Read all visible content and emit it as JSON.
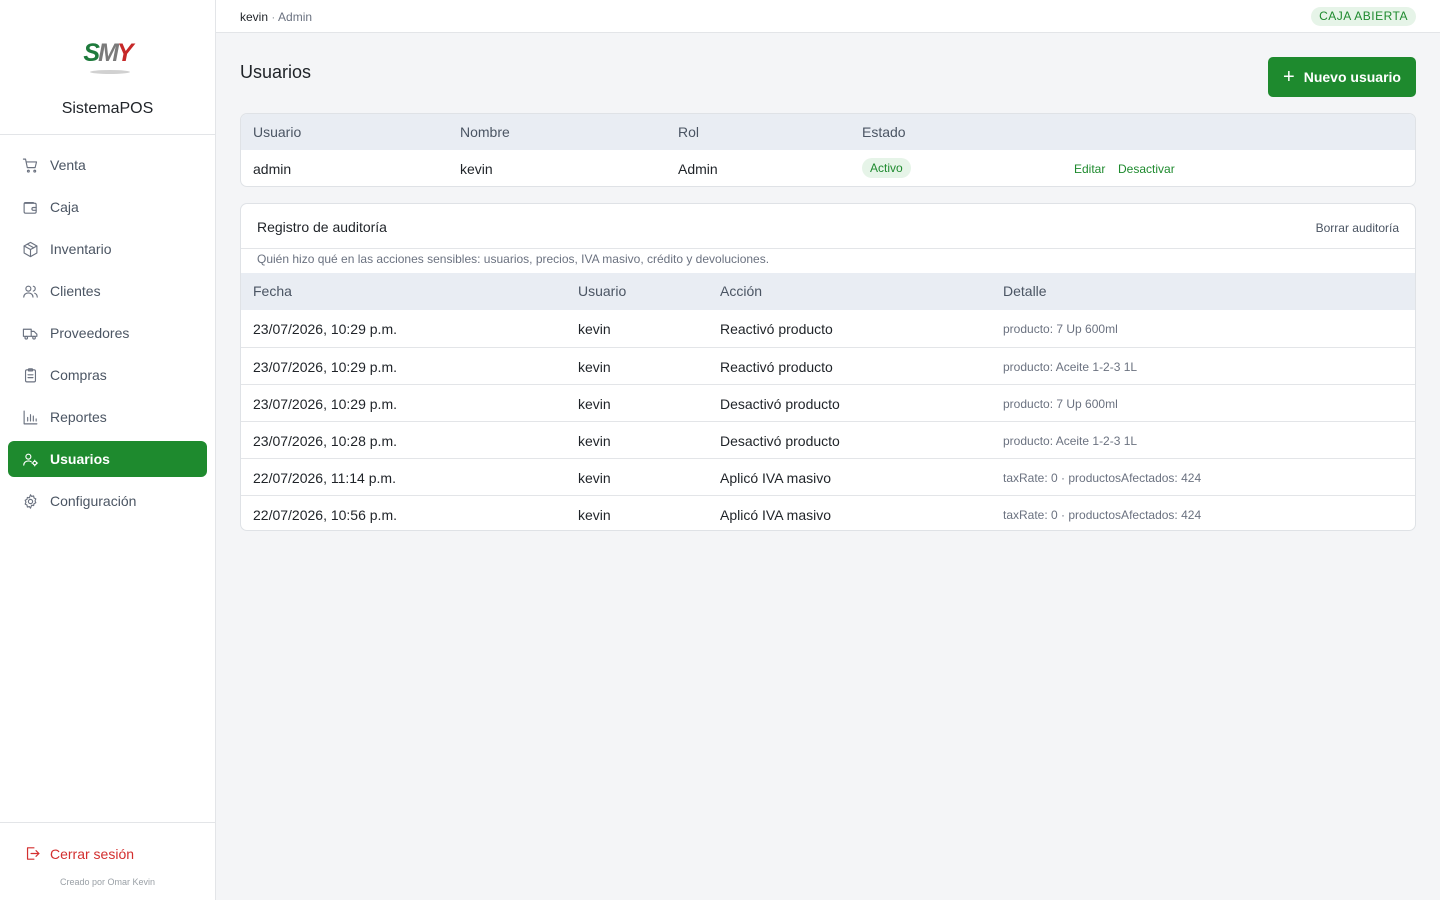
{
  "app": {
    "brand_logo_text": "SMY",
    "brand_name": "SistemaPOS"
  },
  "sidebar": {
    "items": [
      {
        "label": "Venta",
        "icon": "cart-icon"
      },
      {
        "label": "Caja",
        "icon": "wallet-icon"
      },
      {
        "label": "Inventario",
        "icon": "package-icon"
      },
      {
        "label": "Clientes",
        "icon": "users-icon"
      },
      {
        "label": "Proveedores",
        "icon": "truck-icon"
      },
      {
        "label": "Compras",
        "icon": "clipboard-icon"
      },
      {
        "label": "Reportes",
        "icon": "bar-chart-icon"
      },
      {
        "label": "Usuarios",
        "icon": "user-gear-icon",
        "active": true
      },
      {
        "label": "Configuración",
        "icon": "gear-icon"
      }
    ],
    "logout_label": "Cerrar sesión",
    "credit": "Creado por Omar Kevin"
  },
  "topbar": {
    "username": "kevin",
    "separator": "·",
    "role": "Admin",
    "caja_status": "CAJA ABIERTA"
  },
  "page": {
    "title": "Usuarios",
    "new_button_label": "Nuevo usuario"
  },
  "users_table": {
    "headers": [
      "Usuario",
      "Nombre",
      "Rol",
      "Estado"
    ],
    "rows": [
      {
        "usuario": "admin",
        "nombre": "kevin",
        "rol": "Admin",
        "estado": "Activo",
        "edit_label": "Editar",
        "deactivate_label": "Desactivar"
      }
    ]
  },
  "audit": {
    "title": "Registro de auditoría",
    "clear_label": "Borrar auditoría",
    "description": "Quién hizo qué en las acciones sensibles: usuarios, precios, IVA masivo, crédito y devoluciones.",
    "headers": [
      "Fecha",
      "Usuario",
      "Acción",
      "Detalle"
    ],
    "rows": [
      {
        "fecha": "23/07/2026, 10:29 p.m.",
        "usuario": "kevin",
        "accion": "Reactivó producto",
        "detalle": "producto: 7 Up 600ml"
      },
      {
        "fecha": "23/07/2026, 10:29 p.m.",
        "usuario": "kevin",
        "accion": "Reactivó producto",
        "detalle": "producto: Aceite 1-2-3 1L"
      },
      {
        "fecha": "23/07/2026, 10:29 p.m.",
        "usuario": "kevin",
        "accion": "Desactivó producto",
        "detalle": "producto: 7 Up 600ml"
      },
      {
        "fecha": "23/07/2026, 10:28 p.m.",
        "usuario": "kevin",
        "accion": "Desactivó producto",
        "detalle": "producto: Aceite 1-2-3 1L"
      },
      {
        "fecha": "22/07/2026, 11:14 p.m.",
        "usuario": "kevin",
        "accion": "Aplicó IVA masivo",
        "detalle": "taxRate: 0 · productosAfectados: 424"
      },
      {
        "fecha": "22/07/2026, 10:56 p.m.",
        "usuario": "kevin",
        "accion": "Aplicó IVA masivo",
        "detalle": "taxRate: 0 · productosAfectados: 424"
      }
    ]
  },
  "colors": {
    "primary_green": "#1e8a2e",
    "badge_green_bg": "#e6f4e8",
    "danger_red": "#d32f2f",
    "table_header_bg": "#e9edf3"
  }
}
